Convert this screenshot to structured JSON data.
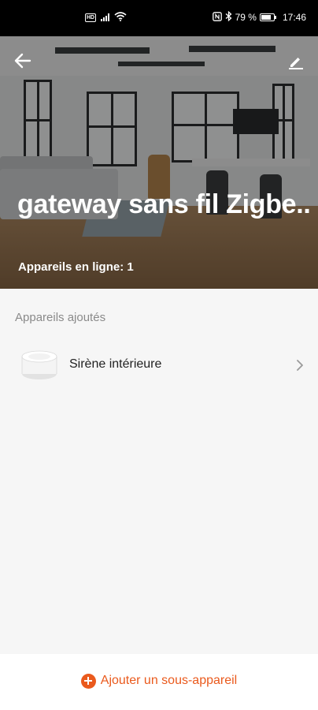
{
  "status_bar": {
    "battery_percent": "79 %",
    "time": "17:46",
    "battery_level": 0.79,
    "icons": [
      "hd-icon",
      "signal-4g-icon",
      "wifi-icon",
      "nfc-icon",
      "bluetooth-icon",
      "battery-icon"
    ]
  },
  "header": {
    "title": "gateway sans fil Zigbe..",
    "online_label": "Appareils en ligne: 1"
  },
  "devices": {
    "section_label": "Appareils ajoutés",
    "items": [
      {
        "name": "Sirène intérieure",
        "icon": "siren-device-icon"
      }
    ]
  },
  "footer": {
    "add_label": "Ajouter un sous-appareil",
    "accent_color": "#ea5a1d"
  }
}
